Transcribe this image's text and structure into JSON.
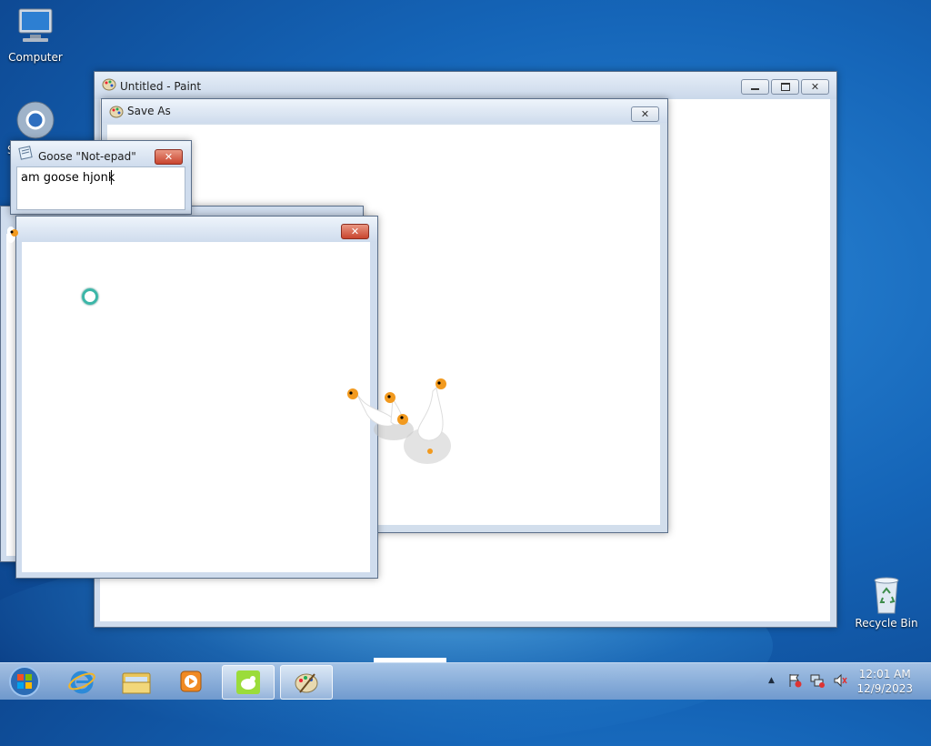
{
  "desktop": {
    "icons": [
      {
        "label": "Computer"
      },
      {
        "label": "S"
      },
      {
        "label": "Recycle Bin"
      }
    ]
  },
  "paint_window": {
    "title": "Untitled - Paint"
  },
  "save_as_dialog": {
    "title": "Save As"
  },
  "notepad_window": {
    "title": "Goose \"Not-epad\"",
    "text": "am goose hjonk"
  },
  "blank_window": {
    "title": ""
  },
  "taskbar": {
    "items": [
      "start-orb",
      "internet-explorer",
      "file-explorer",
      "media-player",
      "goose-app",
      "paint-app"
    ],
    "clock_time": "12:01 AM",
    "clock_date": "12/9/2023"
  },
  "colors": {
    "desktop_blue": "#1565b8",
    "titlebar": "#cfdced",
    "close_red": "#c9452f",
    "goose_orange": "#f29a1f"
  }
}
